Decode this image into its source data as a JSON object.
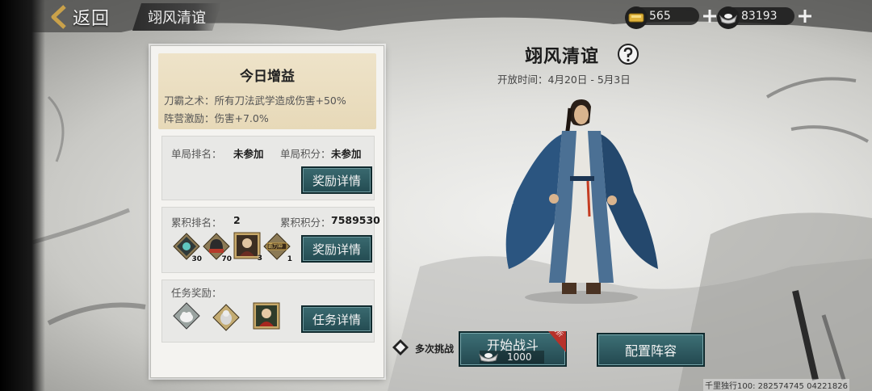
{
  "header": {
    "back_label": "返回",
    "page_title": "翊风清谊",
    "gold": "565",
    "silver": "83193"
  },
  "buff": {
    "title": "今日增益",
    "line1": "刀霸之术：所有刀法武学造成伤害+50%",
    "line2": "阵营激励：伤害+7.0%"
  },
  "single": {
    "rank_label": "单局排名：",
    "rank_value": "未参加",
    "score_label": "单局积分：",
    "score_value": "未参加",
    "button": "奖励详情"
  },
  "cumulative": {
    "rank_label": "累积排名：",
    "rank_value": "2",
    "score_label": "累积积分：",
    "score_value": "7589530",
    "button": "奖励详情",
    "items": [
      {
        "icon": "dark-token-icon",
        "count": "30"
      },
      {
        "icon": "helmet-armor-icon",
        "count": "70"
      },
      {
        "icon": "hero-portrait-icon",
        "count": "3"
      },
      {
        "icon": "title-badge-icon",
        "count": "1",
        "badge_text": "霸刀神"
      }
    ]
  },
  "task": {
    "label": "任务奖励：",
    "button": "任务详情",
    "items": [
      {
        "icon": "white-cat-icon"
      },
      {
        "icon": "cat-figure-icon"
      },
      {
        "icon": "red-robed-portrait-icon"
      }
    ]
  },
  "event": {
    "name": "翊风清谊",
    "open_time": "开放时间：4月20日 - 5月3日"
  },
  "actions": {
    "multi_label": "多次挑战",
    "start_label": "开始战斗",
    "start_cost": "1000",
    "discount": "5.0折",
    "lineup_label": "配置阵容"
  },
  "watermark": "千里独行100: 282574745  04221826",
  "colors": {
    "button_teal": "#2f5d63",
    "buff_bg": "#e9dcbc",
    "discount_red": "#b7312a"
  }
}
